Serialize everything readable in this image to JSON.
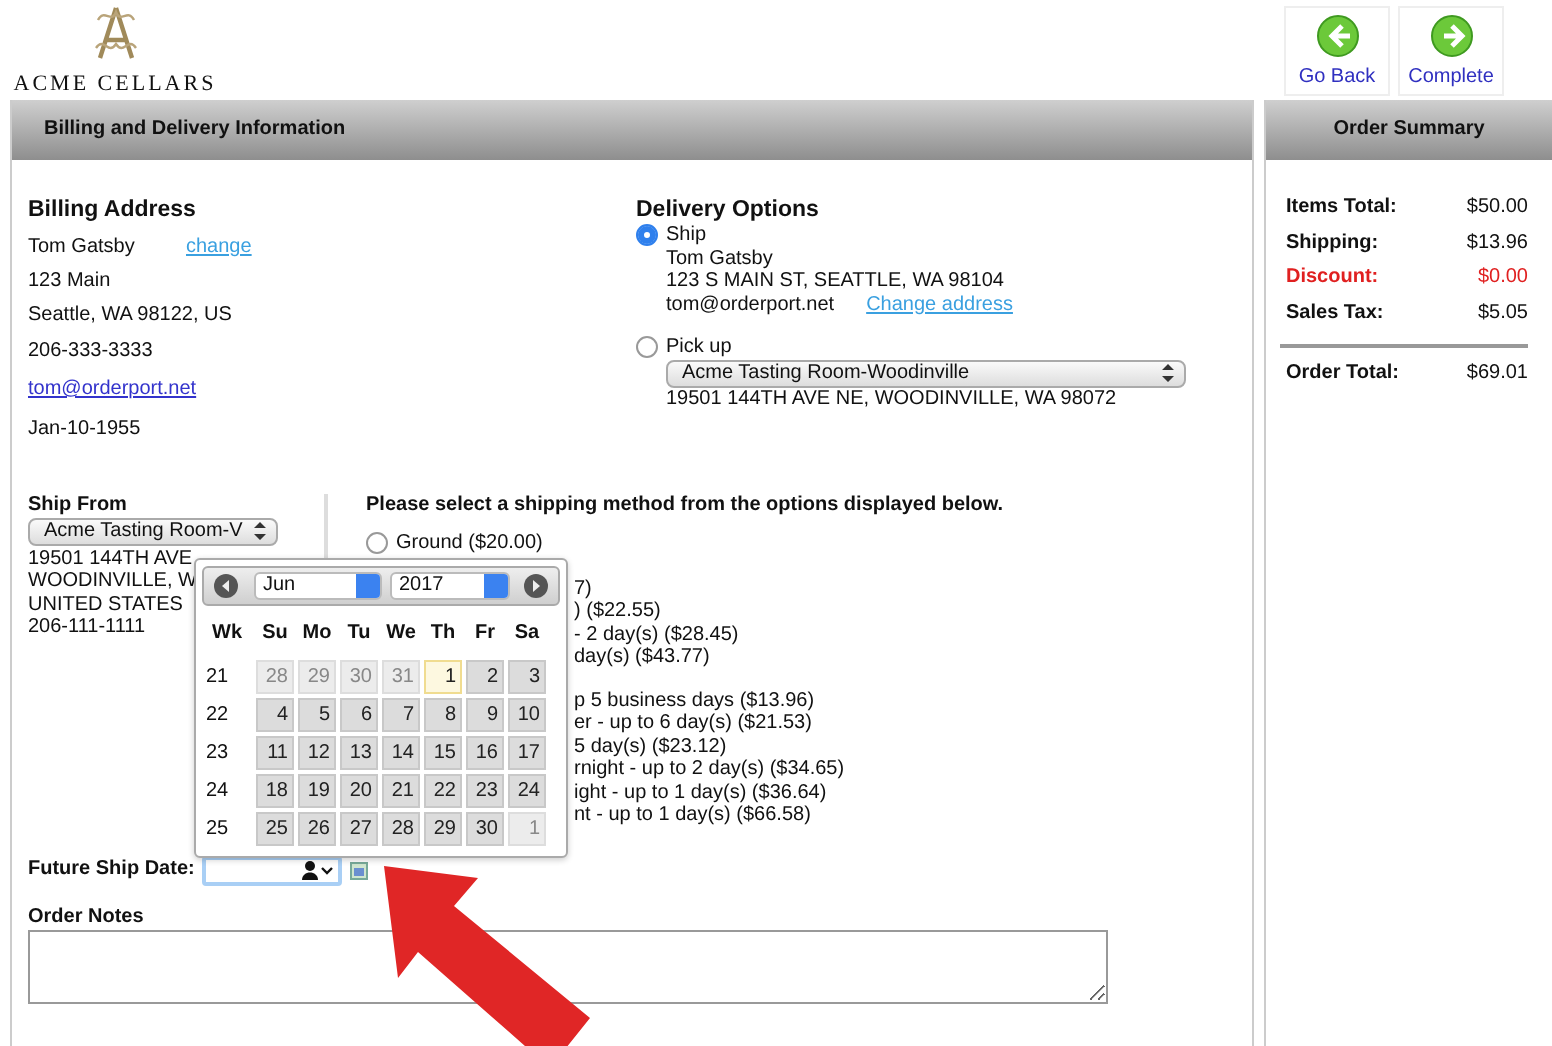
{
  "logo": {
    "text": "ACME CELLARS"
  },
  "actions": [
    {
      "label": "Go Back",
      "kind": "back"
    },
    {
      "label": "Complete",
      "kind": "forward"
    }
  ],
  "billing_panel": {
    "title": "Billing and Delivery Information"
  },
  "billing": {
    "heading": "Billing Address",
    "name": "Tom Gatsby",
    "change_link": "change",
    "lines": [
      "123 Main",
      "Seattle, WA 98122, US",
      "206-333-3333"
    ],
    "email": "tom@orderport.net",
    "birthdate": "Jan-10-1955"
  },
  "delivery": {
    "heading": "Delivery Options",
    "options": [
      {
        "label": "Ship",
        "selected": true,
        "kind": "ship",
        "lines": [
          "Tom Gatsby",
          "123 S MAIN ST, SEATTLE, WA 98104"
        ],
        "email": "tom@orderport.net",
        "link": "Change address"
      },
      {
        "label": "Pick up",
        "selected": false,
        "kind": "pickup",
        "select_value": "Acme Tasting Room-Woodinville",
        "address": "19501 144TH AVE NE, WOODINVILLE, WA 98072"
      }
    ]
  },
  "ship_from": {
    "heading": "Ship From",
    "select_value": "Acme Tasting Room-V",
    "lines": [
      "19501 144TH AVE",
      "WOODINVILLE, W",
      "UNITED STATES",
      "206-111-1111"
    ]
  },
  "shipping": {
    "prompt": "Please select a shipping method from the options displayed below.",
    "first_option": {
      "label": "Ground ($20.00)",
      "selected": false
    },
    "groups": [
      [
        "7)",
        ") ($22.55)",
        "- 2 day(s) ($28.45)",
        "day(s) ($43.77)"
      ],
      [
        "p 5 business days ($13.96)",
        "er - up to 6 day(s) ($21.53)",
        "5 day(s) ($23.12)",
        "rnight - up to 2 day(s) ($34.65)",
        "ight - up to 1 day(s) ($36.64)",
        "nt - up to 1 day(s) ($66.58)"
      ]
    ]
  },
  "calendar": {
    "month": "Jun",
    "year": "2017",
    "headers": [
      "Wk",
      "Su",
      "Mo",
      "Tu",
      "We",
      "Th",
      "Fr",
      "Sa"
    ],
    "weeks": [
      {
        "wk": "21",
        "days": [
          {
            "d": "28",
            "other_month": true,
            "today": false
          },
          {
            "d": "29",
            "other_month": true,
            "today": false
          },
          {
            "d": "30",
            "other_month": true,
            "today": false
          },
          {
            "d": "31",
            "other_month": true,
            "today": false
          },
          {
            "d": "1",
            "other_month": false,
            "today": true
          },
          {
            "d": "2",
            "other_month": false,
            "today": false
          },
          {
            "d": "3",
            "other_month": false,
            "today": false
          }
        ]
      },
      {
        "wk": "22",
        "days": [
          {
            "d": "4",
            "other_month": false,
            "today": false
          },
          {
            "d": "5",
            "other_month": false,
            "today": false
          },
          {
            "d": "6",
            "other_month": false,
            "today": false
          },
          {
            "d": "7",
            "other_month": false,
            "today": false
          },
          {
            "d": "8",
            "other_month": false,
            "today": false
          },
          {
            "d": "9",
            "other_month": false,
            "today": false
          },
          {
            "d": "10",
            "other_month": false,
            "today": false
          }
        ]
      },
      {
        "wk": "23",
        "days": [
          {
            "d": "11",
            "other_month": false,
            "today": false
          },
          {
            "d": "12",
            "other_month": false,
            "today": false
          },
          {
            "d": "13",
            "other_month": false,
            "today": false
          },
          {
            "d": "14",
            "other_month": false,
            "today": false
          },
          {
            "d": "15",
            "other_month": false,
            "today": false
          },
          {
            "d": "16",
            "other_month": false,
            "today": false
          },
          {
            "d": "17",
            "other_month": false,
            "today": false
          }
        ]
      },
      {
        "wk": "24",
        "days": [
          {
            "d": "18",
            "other_month": false,
            "today": false
          },
          {
            "d": "19",
            "other_month": false,
            "today": false
          },
          {
            "d": "20",
            "other_month": false,
            "today": false
          },
          {
            "d": "21",
            "other_month": false,
            "today": false
          },
          {
            "d": "22",
            "other_month": false,
            "today": false
          },
          {
            "d": "23",
            "other_month": false,
            "today": false
          },
          {
            "d": "24",
            "other_month": false,
            "today": false
          }
        ]
      },
      {
        "wk": "25",
        "days": [
          {
            "d": "25",
            "other_month": false,
            "today": false
          },
          {
            "d": "26",
            "other_month": false,
            "today": false
          },
          {
            "d": "27",
            "other_month": false,
            "today": false
          },
          {
            "d": "28",
            "other_month": false,
            "today": false
          },
          {
            "d": "29",
            "other_month": false,
            "today": false
          },
          {
            "d": "30",
            "other_month": false,
            "today": false
          },
          {
            "d": "1",
            "other_month": true,
            "today": false
          }
        ]
      }
    ]
  },
  "future_ship_date": {
    "label": "Future Ship Date:"
  },
  "order_notes": {
    "label": "Order Notes"
  },
  "summary": {
    "title": "Order Summary",
    "rows": [
      {
        "label": "Items Total:",
        "value": "$50.00",
        "kind": "normal"
      },
      {
        "label": "Shipping:",
        "value": "$13.96",
        "kind": "normal"
      },
      {
        "label": "Discount:",
        "value": "$0.00",
        "kind": "discount"
      },
      {
        "label": "Sales Tax:",
        "value": "$5.05",
        "kind": "normal"
      },
      {
        "label": "Order Total:",
        "value": "$69.01",
        "kind": "total"
      }
    ]
  }
}
